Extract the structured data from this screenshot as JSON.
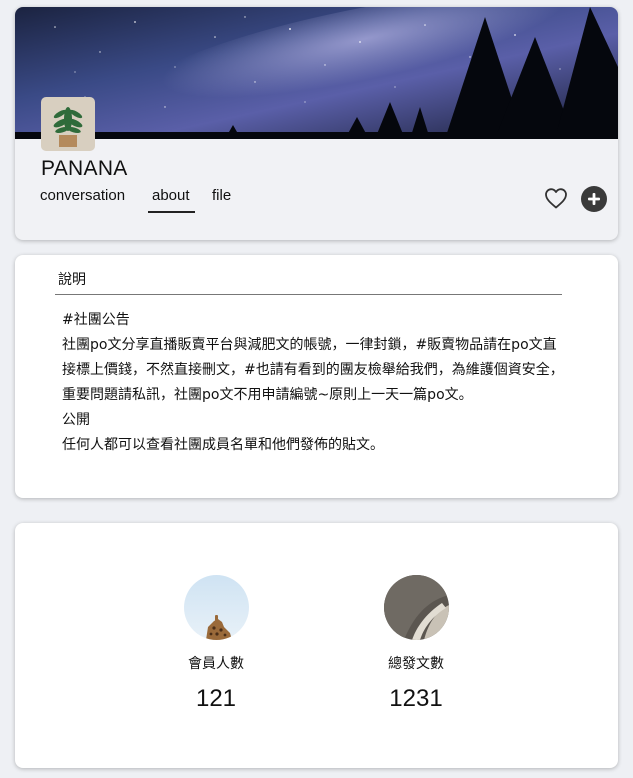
{
  "group": {
    "name": "PANANA"
  },
  "tabs": [
    {
      "label": "conversation"
    },
    {
      "label": "about"
    },
    {
      "label": "file"
    }
  ],
  "active_tab": "about",
  "icons": {
    "favorite": "heart-outline-icon",
    "add": "plus-circle-icon"
  },
  "about": {
    "heading": "說明",
    "lines": [
      "#社團公告",
      "社團po文分享直播販賣平台與減肥文的帳號，一律封鎖，#販賣物品請在po文直",
      "接標上價錢，不然直接刪文，#也請有看到的團友檢舉給我們，為維護個資安全，",
      "重要問題請私訊，社團po文不用申請編號~原則上一天一篇po文。",
      "公開",
      "任何人都可以查看社團成員名單和他們發佈的貼文。"
    ]
  },
  "stats": {
    "members": {
      "label": "會員人數",
      "value": "121"
    },
    "posts": {
      "label": "總發文數",
      "value": "1231"
    }
  },
  "colors": {
    "accent": "#222222",
    "add_button": "#3a3a3a"
  }
}
